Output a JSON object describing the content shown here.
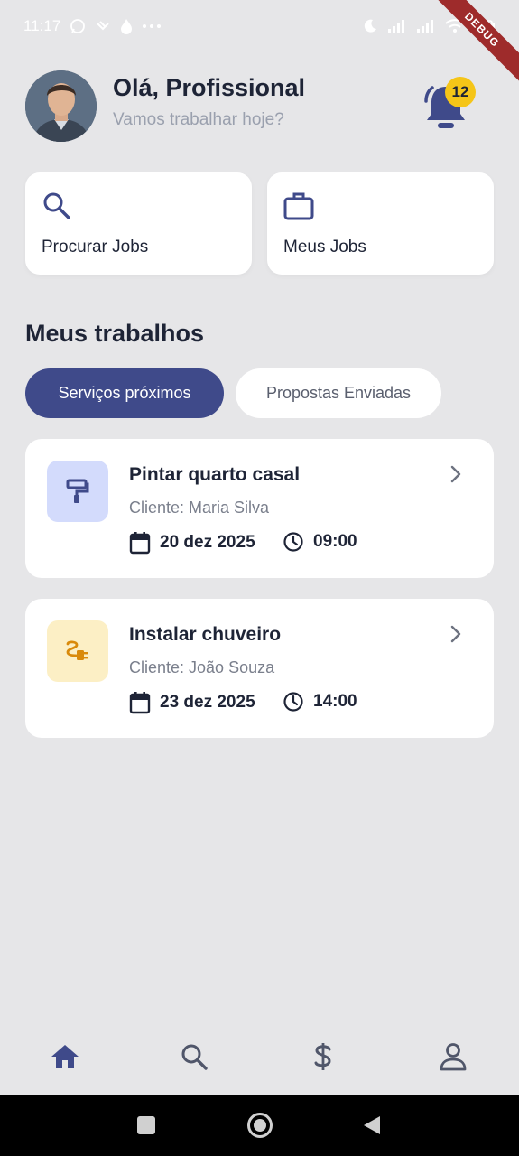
{
  "status_bar": {
    "time": "11:17",
    "left_icons": [
      "whatsapp-icon",
      "signal-app-icon",
      "flame-icon",
      "more-dots-icon"
    ],
    "right_icons": [
      "moon-icon",
      "signal-icon",
      "signal-icon",
      "wifi-icon",
      "battery-icon"
    ]
  },
  "debug_ribbon": {
    "label": "DEBUG"
  },
  "header": {
    "greeting": "Olá, Profissional",
    "subtitle": "Vamos trabalhar hoje?",
    "notification_count": "12"
  },
  "quick_actions": [
    {
      "label": "Procurar Jobs",
      "icon": "search-icon"
    },
    {
      "label": "Meus Jobs",
      "icon": "briefcase-icon"
    }
  ],
  "section_title": "Meus trabalhos",
  "tabs": [
    {
      "label": "Serviços próximos",
      "active": true
    },
    {
      "label": "Propostas Enviadas",
      "active": false
    }
  ],
  "jobs": [
    {
      "title": "Pintar quarto casal",
      "client": "Cliente: Maria Silva",
      "date": "20 dez 2025",
      "time": "09:00",
      "icon": "paint-roller-icon",
      "icon_bg": "#d3dbfc",
      "icon_color": "#3f4a8a"
    },
    {
      "title": "Instalar chuveiro",
      "client": "Cliente: João Souza",
      "date": "23 dez 2025",
      "time": "14:00",
      "icon": "plug-icon",
      "icon_bg": "#fcefc5",
      "icon_color": "#d98a0b"
    }
  ],
  "bottom_nav": [
    {
      "icon": "home-icon",
      "active": true
    },
    {
      "icon": "search-icon",
      "active": false
    },
    {
      "icon": "dollar-icon",
      "active": false
    },
    {
      "icon": "profile-icon",
      "active": false
    }
  ],
  "colors": {
    "primary": "#3f4a8a",
    "background": "#e6e6e8",
    "badge": "#f5c518",
    "text_dark": "#1e2436",
    "text_muted": "#7a7f8c"
  }
}
